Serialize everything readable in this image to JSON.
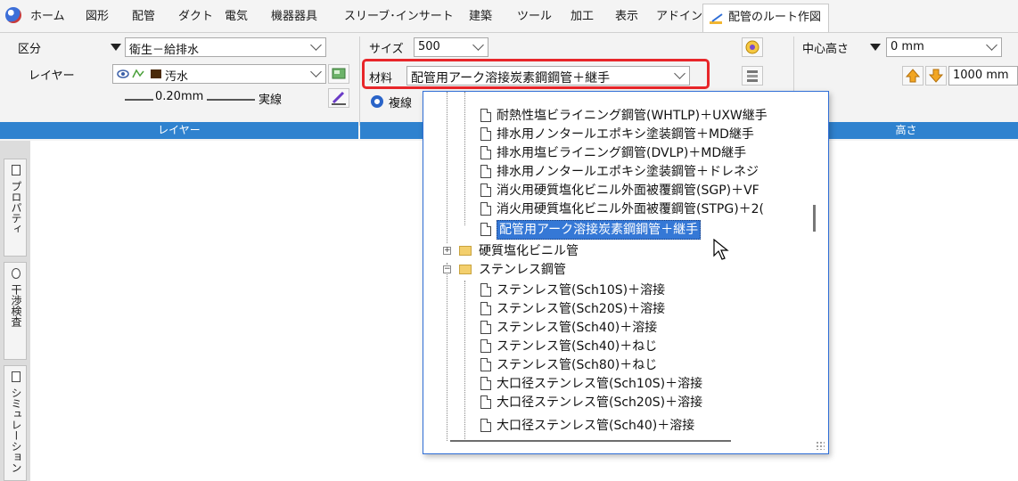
{
  "tabs": [
    "ホーム",
    "図形",
    "配管",
    "ダクト",
    "電気",
    "機器器具",
    "スリーブ･インサート",
    "建築",
    "ツール",
    "加工",
    "表示",
    "アドイン",
    "配管のルート作図"
  ],
  "active_tab": "配管のルート作図",
  "layer_group": {
    "kubun_label": "区分",
    "kubun_value": "衛生－給排水",
    "layer_label": "レイヤー",
    "layer_value": "汚水",
    "layer_color": "#4a2a0a",
    "line_width": "0.20mm",
    "line_type": "実線",
    "footer": "レイヤー"
  },
  "size_group": {
    "size_label": "サイズ",
    "size_value": "500",
    "material_label": "材料",
    "material_value": "配管用アーク溶接炭素鋼鋼管＋継手",
    "multiline_label": "複線"
  },
  "height_group": {
    "center_height_label": "中心高さ",
    "center_height_value": "0 mm",
    "step_value": "1000 mm",
    "footer": "高さ"
  },
  "left_panel": [
    "プロパティ",
    "干渉検査",
    "シミュレーション"
  ],
  "dropdown": {
    "items": [
      {
        "text": "耐熱性塩ビライニング鋼管(WHTLP)＋UXW継手",
        "type": "file"
      },
      {
        "text": "排水用ノンタールエポキシ塗装鋼管＋MD継手",
        "type": "file"
      },
      {
        "text": "排水用塩ビライニング鋼管(DVLP)＋MD継手",
        "type": "file"
      },
      {
        "text": "排水用ノンタールエポキシ塗装鋼管＋ドレネジ",
        "type": "file"
      },
      {
        "text": "消火用硬質塩化ビニル外面被覆鋼管(SGP)＋VF",
        "type": "file"
      },
      {
        "text": "消火用硬質塩化ビニル外面被覆鋼管(STPG)＋2(",
        "type": "file"
      },
      {
        "text": "配管用アーク溶接炭素鋼鋼管＋継手",
        "type": "file",
        "selected": true
      },
      {
        "text": "硬質塩化ビニル管",
        "type": "folder",
        "expanded": false
      },
      {
        "text": "ステンレス鋼管",
        "type": "folder",
        "expanded": true
      },
      {
        "text": "ステンレス管(Sch10S)＋溶接",
        "type": "file"
      },
      {
        "text": "ステンレス管(Sch20S)＋溶接",
        "type": "file"
      },
      {
        "text": "ステンレス管(Sch40)＋溶接",
        "type": "file"
      },
      {
        "text": "ステンレス管(Sch40)＋ねじ",
        "type": "file"
      },
      {
        "text": "ステンレス管(Sch80)＋ねじ",
        "type": "file"
      },
      {
        "text": "大口径ステンレス管(Sch10S)＋溶接",
        "type": "file"
      },
      {
        "text": "大口径ステンレス管(Sch20S)＋溶接",
        "type": "file"
      },
      {
        "text": "大口径ステンレス管(Sch40)＋溶接",
        "type": "file"
      }
    ],
    "expander_plus": "+",
    "expander_minus": "−"
  },
  "colors": {
    "accent": "#2f82cf",
    "highlight": "#e8262a",
    "selection": "#3578d6",
    "folder": "#f3cf6d"
  }
}
